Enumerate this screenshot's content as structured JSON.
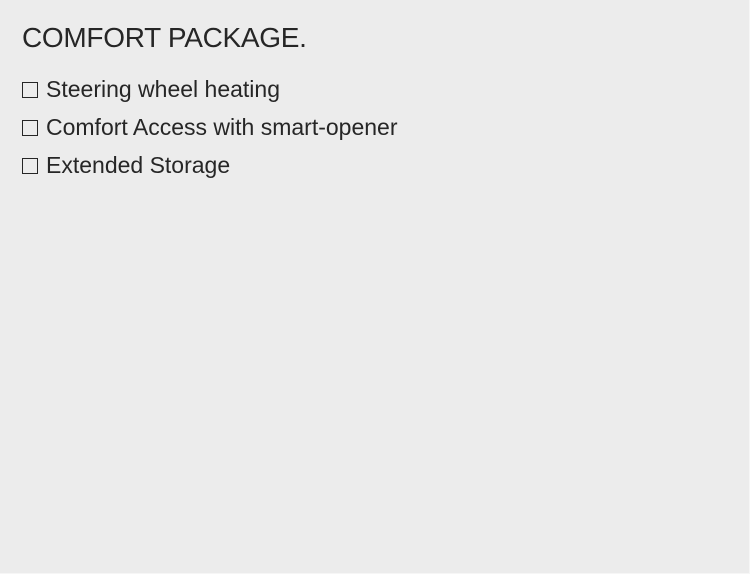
{
  "package": {
    "title": "COMFORT PACKAGE.",
    "options": [
      {
        "label": "Steering wheel heating",
        "checked": false
      },
      {
        "label": "Comfort Access with smart-opener",
        "checked": false
      },
      {
        "label": "Extended Storage",
        "checked": false
      }
    ]
  }
}
